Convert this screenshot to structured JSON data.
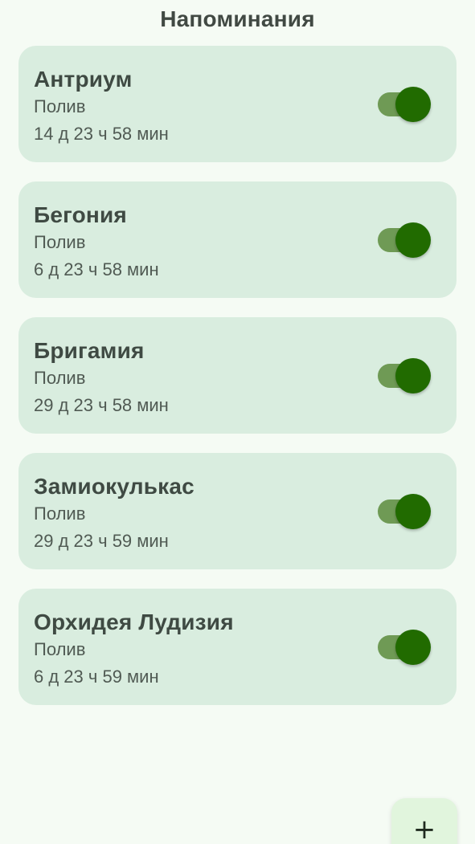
{
  "header": {
    "title": "Напоминания"
  },
  "reminders": [
    {
      "name": "Антриум",
      "type": "Полив",
      "time": "14 д 23 ч 58 мин",
      "enabled": true
    },
    {
      "name": "Бегония",
      "type": "Полив",
      "time": "6 д 23 ч 58 мин",
      "enabled": true
    },
    {
      "name": "Бригамия",
      "type": "Полив",
      "time": "29 д 23 ч 58 мин",
      "enabled": true
    },
    {
      "name": "Замиокулькас",
      "type": "Полив",
      "time": "29 д 23 ч 59 мин",
      "enabled": true
    },
    {
      "name": "Орхидея Лудизия",
      "type": "Полив",
      "time": "6 д 23 ч 59 мин",
      "enabled": true
    }
  ],
  "fab": {
    "icon": "plus-icon",
    "symbol": "+"
  },
  "colors": {
    "background": "#f5fbf4",
    "card": "#d9eddf",
    "toggle_track": "#6f9a55",
    "toggle_thumb": "#216b00",
    "fab": "#e1f5dd"
  }
}
